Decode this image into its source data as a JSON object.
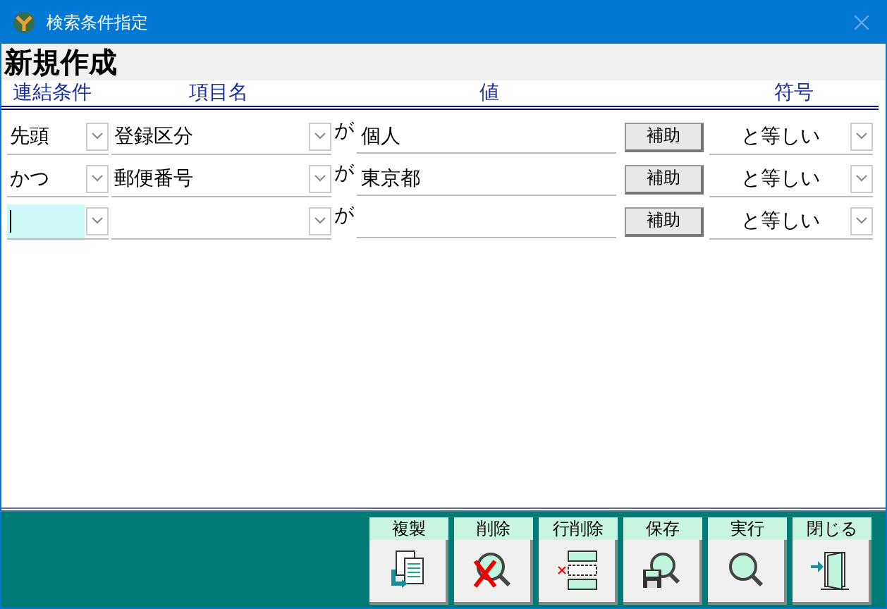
{
  "window": {
    "title": "検索条件指定"
  },
  "heading": "新規作成",
  "columns": [
    "連結条件",
    "項目名",
    "値",
    "符号"
  ],
  "rows": [
    {
      "connector": "先頭",
      "item": "登録区分",
      "particle": "が",
      "value": "個人",
      "assist": "補助",
      "operator": "と等しい",
      "focused": false
    },
    {
      "connector": "かつ",
      "item": "郵便番号",
      "particle": "が",
      "value": "東京都",
      "assist": "補助",
      "operator": "と等しい",
      "focused": false
    },
    {
      "particle": "が",
      "assist": "補助",
      "operator": "と等しい",
      "focused": true
    }
  ],
  "buttons": [
    {
      "label": "複製",
      "kind": "copy"
    },
    {
      "label": "削除",
      "kind": "delete"
    },
    {
      "label": "行削除",
      "kind": "delete-row"
    },
    {
      "label": "保存",
      "kind": "save"
    },
    {
      "label": "実行",
      "kind": "run"
    },
    {
      "label": "閉じる",
      "kind": "close"
    }
  ]
}
